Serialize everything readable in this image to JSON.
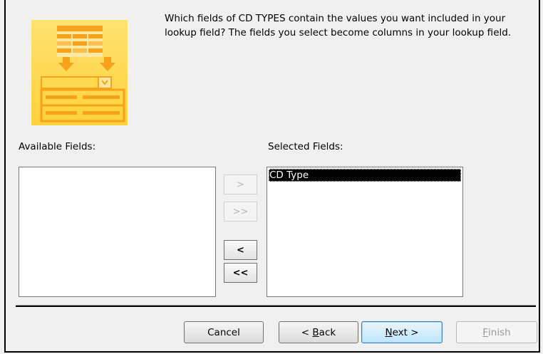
{
  "dialog": {
    "header_text": "Which fields of CD TYPES contain the values you want included in your lookup field? The fields you select become columns in your lookup field.",
    "available_label": "Available Fields:",
    "selected_label": "Selected Fields:",
    "available_fields": [],
    "selected_fields": [
      "CD Type"
    ],
    "selected_index": 0,
    "move_buttons": {
      "add_one": ">",
      "add_all": ">>",
      "remove_one": "<",
      "remove_all": "<<"
    },
    "buttons": {
      "cancel": "Cancel",
      "back_prefix": "< ",
      "back_mnemonic": "B",
      "back_rest": "ack",
      "next_mnemonic": "N",
      "next_rest": "ext >",
      "finish_mnemonic": "F",
      "finish_rest": "inish"
    }
  },
  "colors": {
    "illustration_yellow": "#ffd23a",
    "illustration_orange": "#f7a21b",
    "selection_background": "#000000",
    "default_button_blue": "#3c7fb1"
  }
}
